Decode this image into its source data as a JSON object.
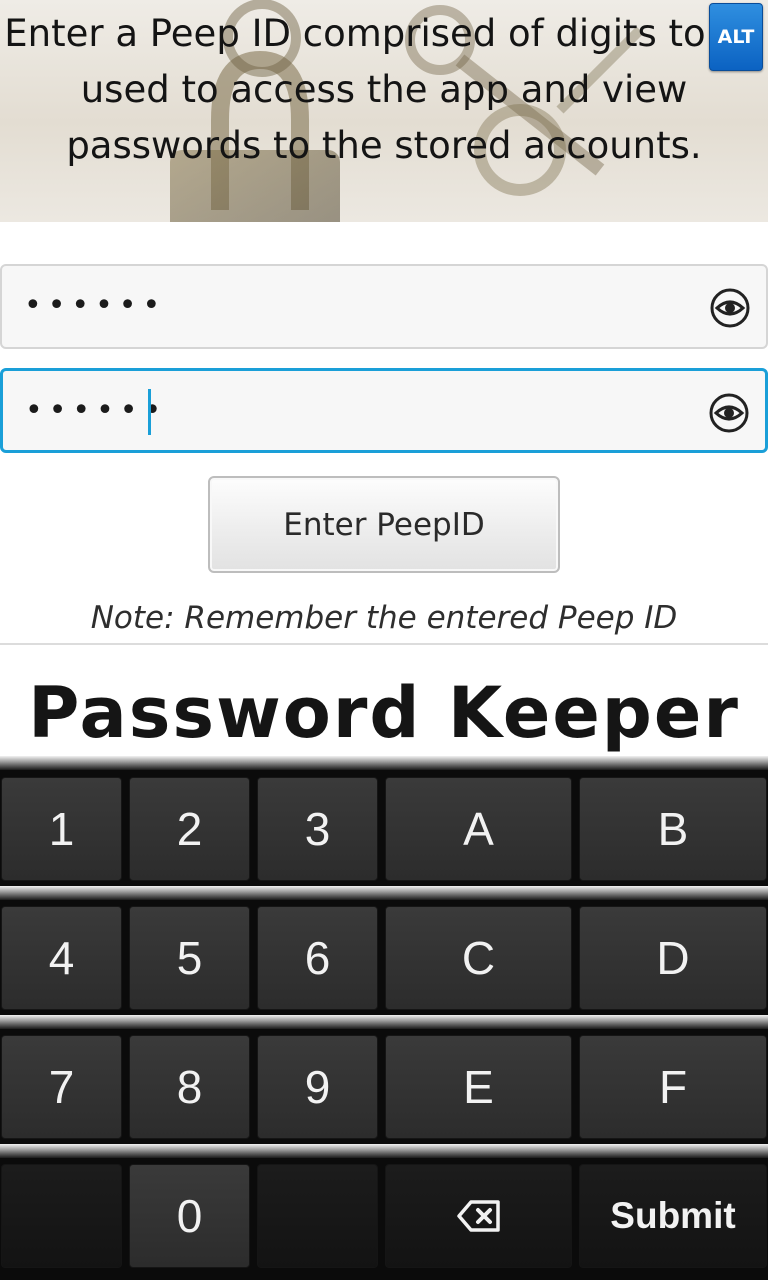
{
  "header": {
    "instruction": "Enter a Peep ID comprised of digits to be used to access the app and view passwords to the stored accounts.",
    "alt_label": "ALT"
  },
  "fields": [
    {
      "value": "••••••",
      "reveal_icon": "eye-icon",
      "focused": false
    },
    {
      "value": "••••••",
      "reveal_icon": "eye-icon",
      "focused": true
    }
  ],
  "enter_button_label": "Enter PeepID",
  "note": "Note: Remember the entered Peep ID",
  "app_title": "Password Keeper",
  "keyboard": {
    "rows": [
      [
        "1",
        "2",
        "3",
        "A",
        "B"
      ],
      [
        "4",
        "5",
        "6",
        "C",
        "D"
      ],
      [
        "7",
        "8",
        "9",
        "E",
        "F"
      ],
      [
        "",
        "0",
        "",
        "backspace-icon",
        "Submit"
      ]
    ]
  },
  "colors": {
    "focus_accent": "#1a9fd8",
    "alt_button": "#1670cf",
    "keyboard_bg": "#0b0b0b"
  }
}
